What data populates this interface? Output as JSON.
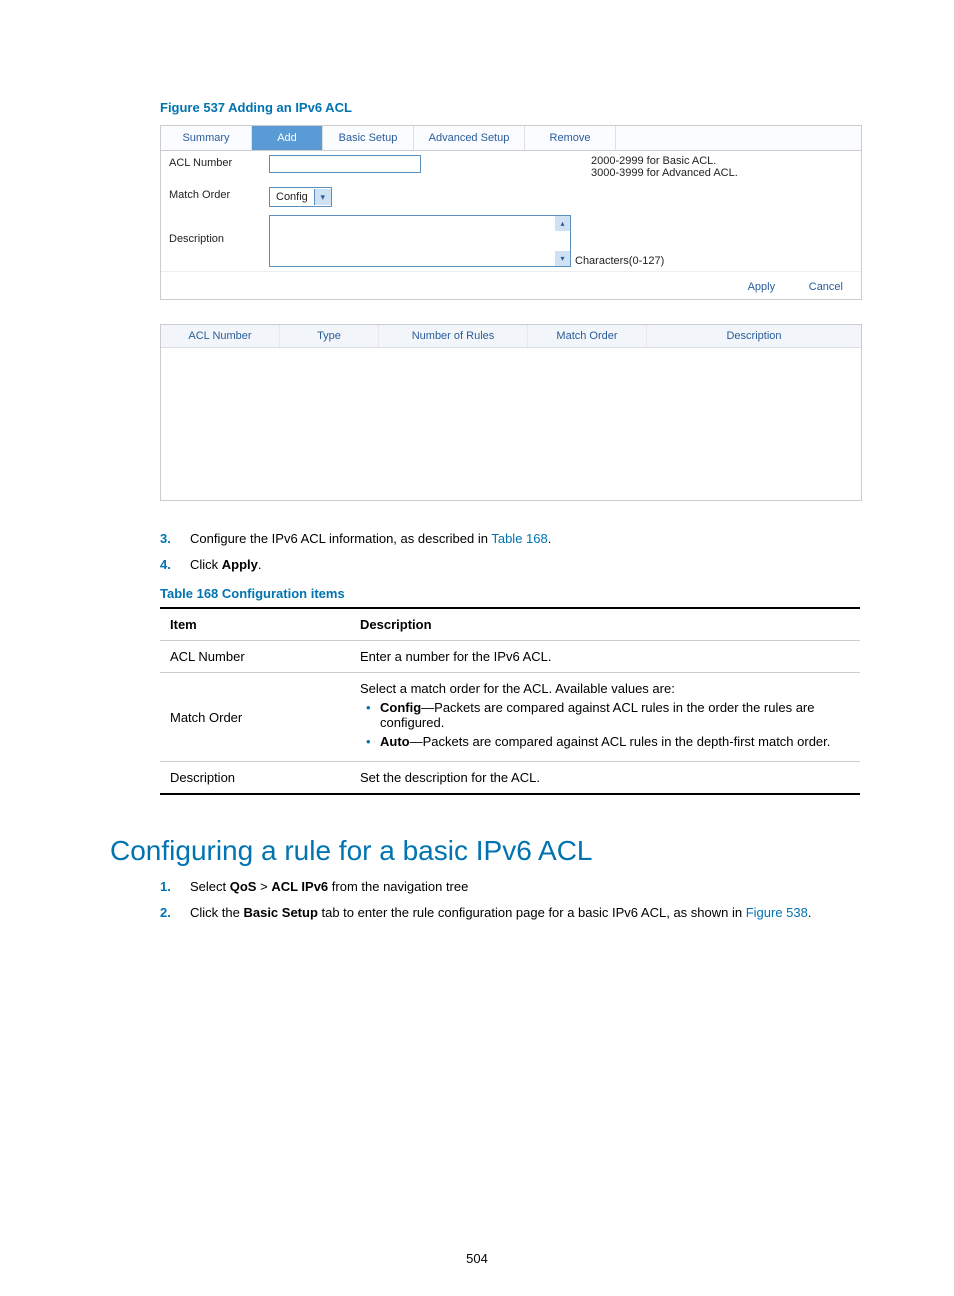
{
  "figure": {
    "caption": "Figure 537 Adding an IPv6 ACL"
  },
  "tabs": {
    "summary": "Summary",
    "add": "Add",
    "basic": "Basic Setup",
    "advanced": "Advanced Setup",
    "remove": "Remove"
  },
  "form": {
    "acl_label": "ACL Number",
    "acl_help_line1": "2000-2999 for Basic ACL.",
    "acl_help_line2": "3000-3999 for Advanced ACL.",
    "match_label": "Match Order",
    "match_value": "Config",
    "desc_label": "Description",
    "char_hint": "Characters(0-127)",
    "apply": "Apply",
    "cancel": "Cancel"
  },
  "listcols": {
    "c1": "ACL Number",
    "c2": "Type",
    "c3": "Number of Rules",
    "c4": "Match Order",
    "c5": "Description"
  },
  "steps_a": {
    "n3": "3.",
    "t3a": "Configure the IPv6 ACL information, as described in ",
    "t3b": "Table 168",
    "t3c": ".",
    "n4": "4.",
    "t4a": "Click ",
    "t4b": "Apply",
    "t4c": "."
  },
  "table_caption": "Table 168 Configuration items",
  "table": {
    "h1": "Item",
    "h2": "Description",
    "r1c1": "ACL Number",
    "r1c2": "Enter a number for the IPv6 ACL.",
    "r2c1": "Match Order",
    "r2_intro": "Select a match order for the ACL. Available values are:",
    "r2_b1a": "Config",
    "r2_b1b": "—Packets are compared against ACL rules in the order the rules are configured.",
    "r2_b2a": "Auto",
    "r2_b2b": "—Packets are compared against ACL rules in the depth-first match order.",
    "r3c1": "Description",
    "r3c2": "Set the description for the ACL."
  },
  "section_title": "Configuring a rule for a basic IPv6 ACL",
  "steps_b": {
    "n1": "1.",
    "t1a": "Select ",
    "t1b": "QoS",
    "t1c": " > ",
    "t1d": "ACL IPv6",
    "t1e": " from the navigation tree",
    "n2": "2.",
    "t2a": "Click the ",
    "t2b": "Basic Setup",
    "t2c": " tab to enter the rule configuration page for a basic IPv6 ACL, as shown in ",
    "t2d": "Figure 538",
    "t2e": "."
  },
  "page_number": "504"
}
